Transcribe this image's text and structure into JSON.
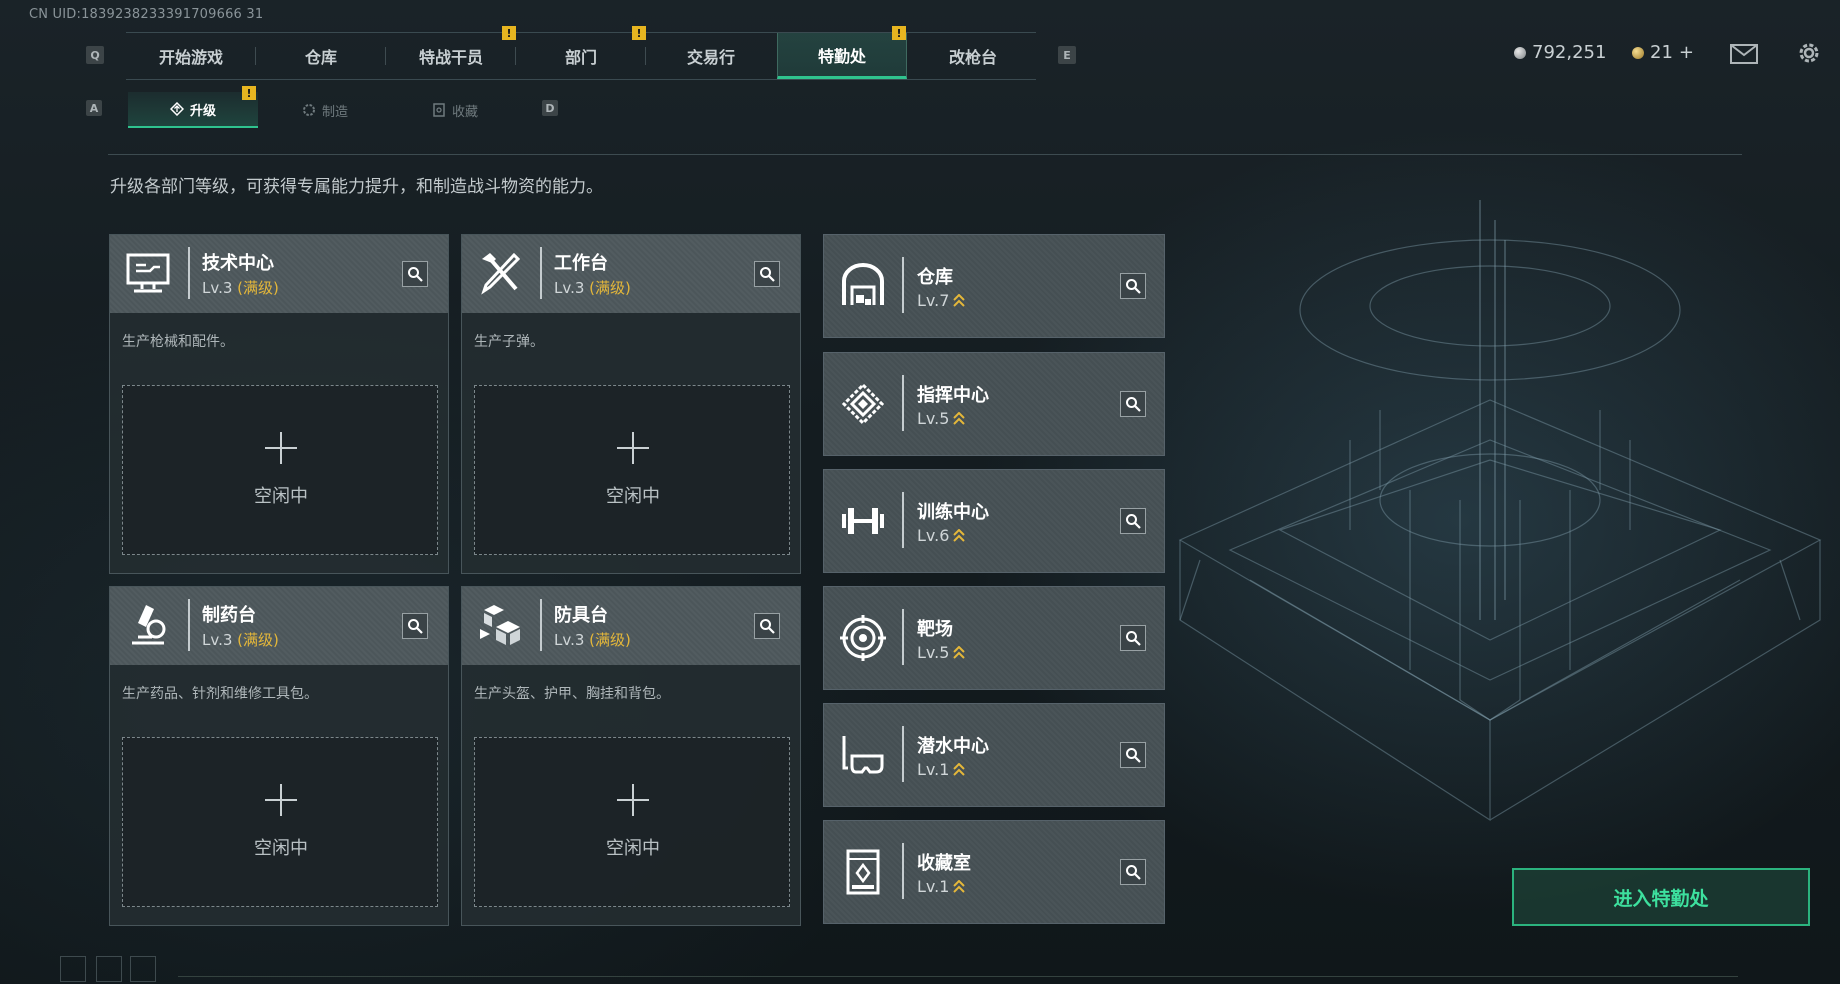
{
  "uid": "CN UID:1839238233391709666 31",
  "nav": {
    "key_left": "Q",
    "key_right": "E",
    "tabs": [
      {
        "label": "开始游戏",
        "warn": false,
        "active": false
      },
      {
        "label": "仓库",
        "warn": false,
        "active": false
      },
      {
        "label": "特战干员",
        "warn": true,
        "active": false
      },
      {
        "label": "部门",
        "warn": true,
        "active": false
      },
      {
        "label": "交易行",
        "warn": false,
        "active": false
      },
      {
        "label": "特勤处",
        "warn": true,
        "active": true
      },
      {
        "label": "改枪台",
        "warn": false,
        "active": false
      }
    ],
    "warn_glyph": "!"
  },
  "currency": {
    "coins": "792,251",
    "gold": "21",
    "plus": "+"
  },
  "subnav": {
    "key_left": "A",
    "key_right": "D",
    "tabs": [
      {
        "label": "升级",
        "active": true,
        "warn": true
      },
      {
        "label": "制造",
        "active": false,
        "warn": false
      },
      {
        "label": "收藏",
        "active": false,
        "warn": false
      }
    ]
  },
  "description": "升级各部门等级，可获得专属能力提升，和制造战斗物资的能力。",
  "facilities": [
    {
      "name": "技术中心",
      "level": "Lv.3",
      "max": "(满级)",
      "desc": "生产枪械和配件。",
      "slot": "空闲中",
      "icon": "computer-icon"
    },
    {
      "name": "工作台",
      "level": "Lv.3",
      "max": "(满级)",
      "desc": "生产子弹。",
      "slot": "空闲中",
      "icon": "tools-icon"
    },
    {
      "name": "制药台",
      "level": "Lv.3",
      "max": "(满级)",
      "desc": "生产药品、针剂和维修工具包。",
      "slot": "空闲中",
      "icon": "microscope-icon"
    },
    {
      "name": "防具台",
      "level": "Lv.3",
      "max": "(满级)",
      "desc": "生产头盔、护甲、胸挂和背包。",
      "slot": "空闲中",
      "icon": "cubes-icon"
    }
  ],
  "departments": [
    {
      "name": "仓库",
      "level": "Lv.7",
      "icon": "warehouse-icon"
    },
    {
      "name": "指挥中心",
      "level": "Lv.5",
      "icon": "chip-icon"
    },
    {
      "name": "训练中心",
      "level": "Lv.6",
      "icon": "dumbbell-icon"
    },
    {
      "name": "靶场",
      "level": "Lv.5",
      "icon": "target-icon"
    },
    {
      "name": "潜水中心",
      "level": "Lv.1",
      "icon": "diving-mask-icon"
    },
    {
      "name": "收藏室",
      "level": "Lv.1",
      "icon": "display-case-icon"
    }
  ],
  "enter_button": "进入特勤处",
  "colors": {
    "accent": "#2fc38e",
    "warn": "#e7b520",
    "max_level": "#e4b73a"
  }
}
